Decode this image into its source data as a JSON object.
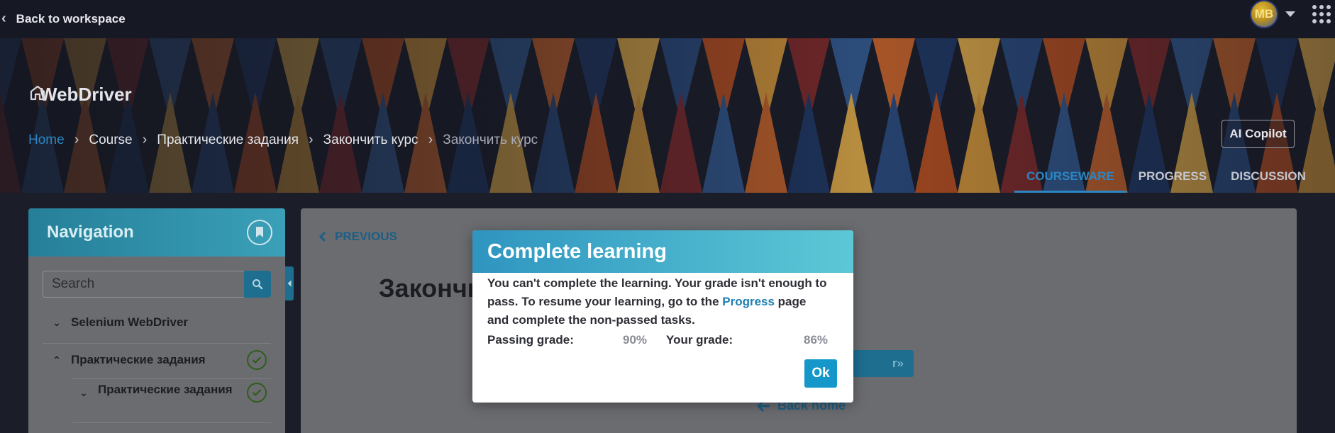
{
  "topbar": {
    "back_label": "Back to workspace",
    "avatar_initials": "MB"
  },
  "course": {
    "title": "WebDriver"
  },
  "breadcrumb": [
    "Home",
    "Course",
    "Практические задания",
    "Закончить курс",
    "Закончить курс"
  ],
  "ai_copilot_label": "AI Copilot",
  "tabs": [
    {
      "label": "COURSEWARE",
      "active": true
    },
    {
      "label": "PROGRESS",
      "active": false
    },
    {
      "label": "DISCUSSION",
      "active": false
    }
  ],
  "navigation": {
    "title": "Navigation",
    "search_placeholder": "Search",
    "items": [
      {
        "label": "Selenium WebDriver",
        "expanded": false,
        "completed": false
      },
      {
        "label": "Практические задания",
        "expanded": true,
        "completed": true
      },
      {
        "label": "Практические задания",
        "expanded": false,
        "completed": true
      }
    ]
  },
  "content": {
    "previous_label": "PREVIOUS",
    "title_partial": "Закончи",
    "next_partial": "r»",
    "back_home_label": "Back home"
  },
  "modal": {
    "title": "Complete learning",
    "message_before_link": "You can't complete the learning. Your grade isn't enough to pass. To resume your learning, go to the ",
    "link_text": "Progress",
    "message_after_link": " page and complete the non-passed tasks.",
    "passing_grade_label": "Passing grade:",
    "passing_grade_value": "90%",
    "your_grade_label": "Your grade:",
    "your_grade_value": "86%",
    "ok_label": "Ok"
  },
  "colors": {
    "accent": "#1598c9",
    "link": "#2a86c4",
    "success": "#2f5d1b",
    "modal_header_start": "#2f95c0",
    "modal_header_end": "#5cc8d6"
  }
}
